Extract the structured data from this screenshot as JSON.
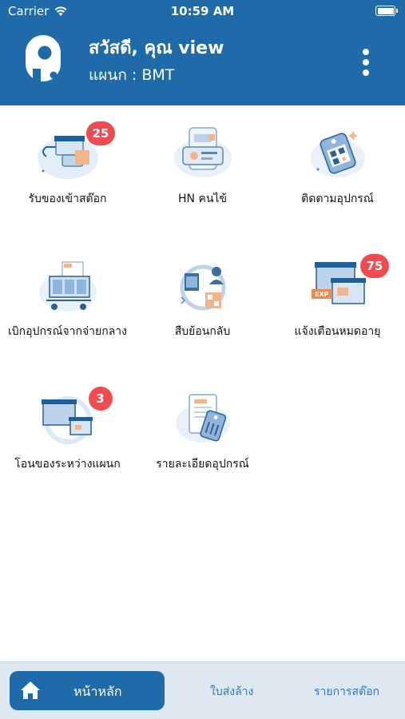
{
  "status_bar": {
    "carrier": "Carrier",
    "time": "10:59 AM"
  },
  "header": {
    "greeting": "สวัสดี, คุณ view",
    "department": "แผนก : BMT"
  },
  "menu": [
    {
      "label": "รับของเข้าสต๊อก",
      "icon": "receive-stock-icon",
      "badge": "25"
    },
    {
      "label": "HN คนไข้",
      "icon": "patient-hn-icon",
      "badge": null
    },
    {
      "label": "ติดตามอุปกรณ์",
      "icon": "track-equipment-icon",
      "badge": null
    },
    {
      "label": "เบิกอุปกรณ์จากจ่ายกลาง",
      "icon": "requisition-icon",
      "badge": null
    },
    {
      "label": "สืบย้อนกลับ",
      "icon": "traceback-icon",
      "badge": null
    },
    {
      "label": "แจ้งเตือนหมดอายุ",
      "icon": "expiry-alert-icon",
      "badge": "75"
    },
    {
      "label": "โอนของระหว่างแผนก",
      "icon": "transfer-icon",
      "badge": "3"
    },
    {
      "label": "รายละเอียดอุปกรณ์",
      "icon": "equipment-detail-icon",
      "badge": null
    }
  ],
  "tab_bar": {
    "home": "หน้าหลัก",
    "wash_slip": "ใบส่งล้าง",
    "stock_list": "รายการสต๊อก"
  },
  "colors": {
    "primary": "#1f6aa8",
    "badge": "#f04b4e",
    "tab_bg": "#dfe7f1",
    "tab_text": "#2f76bc"
  }
}
